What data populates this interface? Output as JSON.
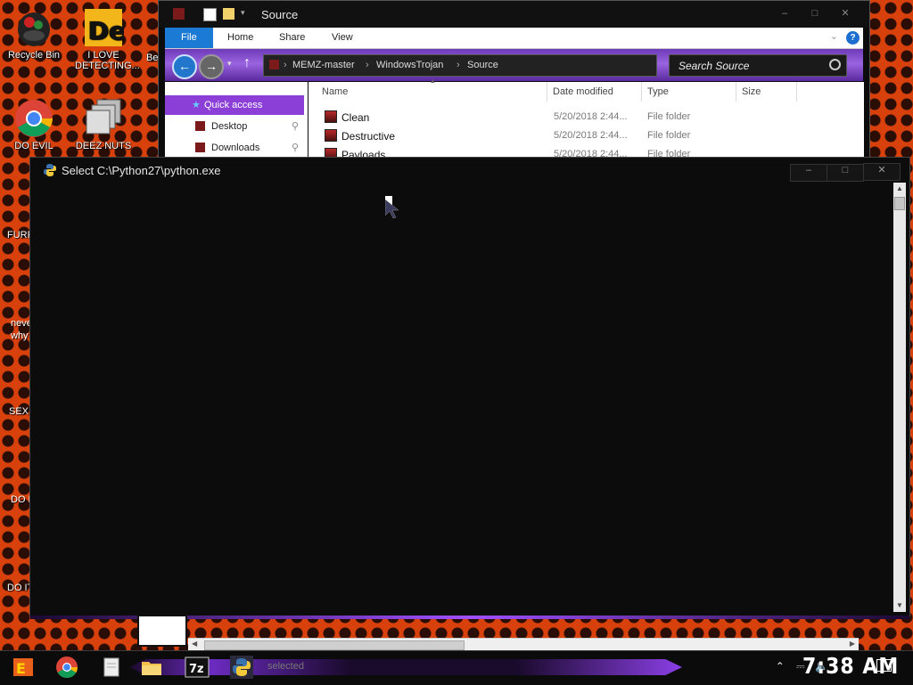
{
  "desktop": {
    "icons": [
      {
        "label": "Recycle Bin"
      },
      {
        "label": "I LOVE DETECTING..."
      },
      {
        "label": "DO EVIL"
      },
      {
        "label": "DEEZ NUTS"
      }
    ],
    "partial_labels": [
      "Be",
      "FURF",
      "neve",
      "why",
      "SEX",
      "DO I",
      "DO IT"
    ]
  },
  "explorer": {
    "title": "Source",
    "ribbon_tabs": [
      "File",
      "Home",
      "Share",
      "View"
    ],
    "breadcrumb": [
      "MEMZ-master",
      "WindowsTrojan",
      "Source"
    ],
    "search_placeholder": "Search Source",
    "nav_items": [
      "Quick access",
      "Desktop",
      "Downloads"
    ],
    "columns": [
      "Name",
      "Date modified",
      "Type",
      "Size"
    ],
    "rows": [
      {
        "name": "Clean",
        "date": "5/20/2018 2:44...",
        "type": "File folder"
      },
      {
        "name": "Destructive",
        "date": "5/20/2018 2:44...",
        "type": "File folder"
      },
      {
        "name": "Payloads",
        "date": "5/20/2018 2:44...",
        "type": "File folder"
      }
    ]
  },
  "console": {
    "title": "Select C:\\Python27\\python.exe"
  },
  "taskbar": {
    "status_text": "selected",
    "clock": "7:38 AM",
    "archive_label": "7z"
  },
  "colors": {
    "accent_purple": "#8b3fd6",
    "desktop_orange": "#d9410c"
  }
}
